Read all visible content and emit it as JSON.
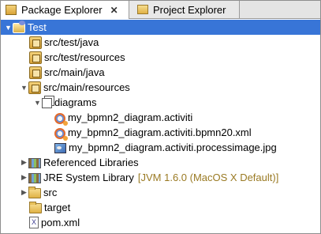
{
  "tabs": [
    {
      "label": "Package Explorer",
      "close_symbol": "✕",
      "icon": "package-explorer-icon",
      "active": true
    },
    {
      "label": "Project Explorer",
      "icon": "project-explorer-icon",
      "active": false
    }
  ],
  "tree": {
    "root": {
      "label": "Test",
      "expand": "▼",
      "icon": "project-icon",
      "selected": true
    },
    "items": [
      {
        "label": "src/test/java",
        "icon": "source-package-icon"
      },
      {
        "label": "src/test/resources",
        "icon": "source-package-icon"
      },
      {
        "label": "src/main/java",
        "icon": "source-package-icon"
      },
      {
        "label": "src/main/resources",
        "expand": "▼",
        "icon": "source-package-icon"
      },
      {
        "label": "diagrams",
        "expand": "▼",
        "icon": "package-icon"
      },
      {
        "label": "my_bpmn2_diagram.activiti",
        "icon": "bpmn-diagram-icon"
      },
      {
        "label": "my_bpmn2_diagram.activiti.bpmn20.xml",
        "icon": "bpmn-diagram-icon"
      },
      {
        "label": "my_bpmn2_diagram.activiti.processimage.jpg",
        "icon": "image-file-icon"
      },
      {
        "label": "Referenced Libraries",
        "expand": "▶",
        "icon": "library-icon"
      },
      {
        "label": "JRE System Library",
        "expand": "▶",
        "icon": "library-icon",
        "suffix": "[JVM 1.6.0 (MacOS X Default)]"
      },
      {
        "label": "src",
        "expand": "▶",
        "icon": "folder-icon"
      },
      {
        "label": "target",
        "icon": "folder-icon"
      },
      {
        "label": "pom.xml",
        "icon": "xml-file-icon",
        "icon_glyph": "X"
      }
    ]
  },
  "colors": {
    "selection": "#3875d7",
    "decoration": "#9a7a23"
  }
}
